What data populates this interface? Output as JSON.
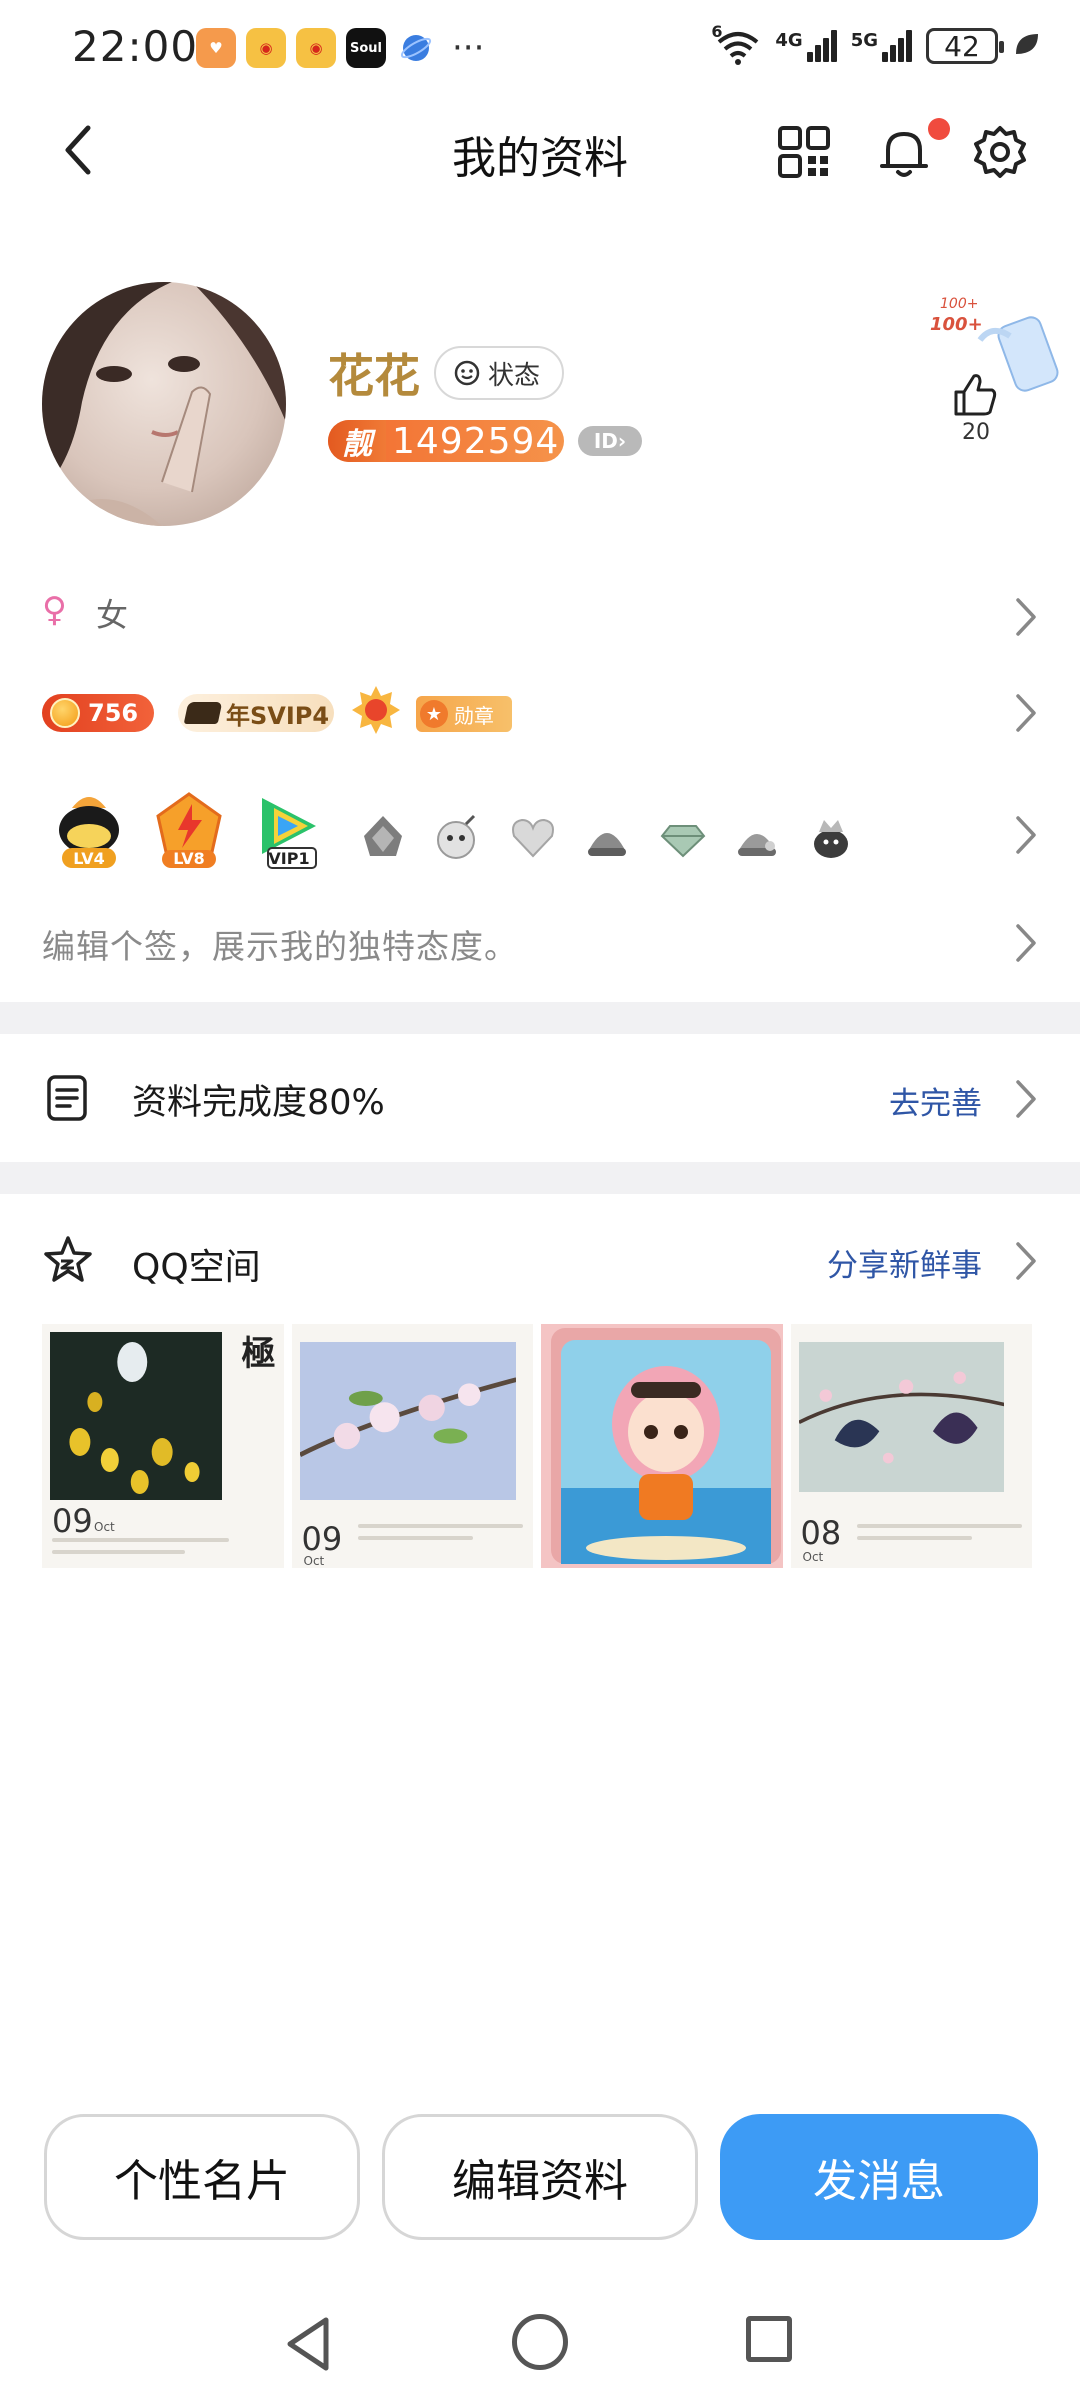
{
  "status_bar": {
    "time": "22:00",
    "app_labels": [
      "Soul"
    ],
    "network_1": "4G",
    "network_2": "5G",
    "wifi_label": "6",
    "battery": "42"
  },
  "nav": {
    "title": "我的资料"
  },
  "profile": {
    "nickname": "花花",
    "status_label": "状态",
    "pretty_label": "靓",
    "qq_number": "1492594",
    "id_label": "ID",
    "like_count": "20",
    "like_sticker": "100+"
  },
  "gender": {
    "symbol": "♀",
    "label": "女"
  },
  "badges": {
    "coin_value": "756",
    "svip_label": "年SVIP4",
    "medal_label": "勋章"
  },
  "level_icons": {
    "lv4": "LV4",
    "lv8": "LV8",
    "vip": "VIP1"
  },
  "signature": {
    "placeholder": "编辑个签，展示我的独特态度。"
  },
  "profile_completion": {
    "label": "资料完成度80%",
    "action": "去完善"
  },
  "qzone": {
    "title": "QQ空间",
    "action": "分享新鲜事",
    "thumbnails": [
      {
        "date": "09",
        "month": "Oct",
        "title_char": "極"
      },
      {
        "date": "09",
        "month": "Oct"
      },
      {
        "date": "",
        "month": ""
      },
      {
        "date": "08",
        "month": "Oct"
      }
    ]
  },
  "actions": {
    "card": "个性名片",
    "edit": "编辑资料",
    "message": "发消息"
  },
  "colors": {
    "accent_blue": "#3d9bf5",
    "link_blue": "#2f56a6",
    "nickname_gold": "#b48a3c",
    "badge_orange": "#f26b2f"
  }
}
